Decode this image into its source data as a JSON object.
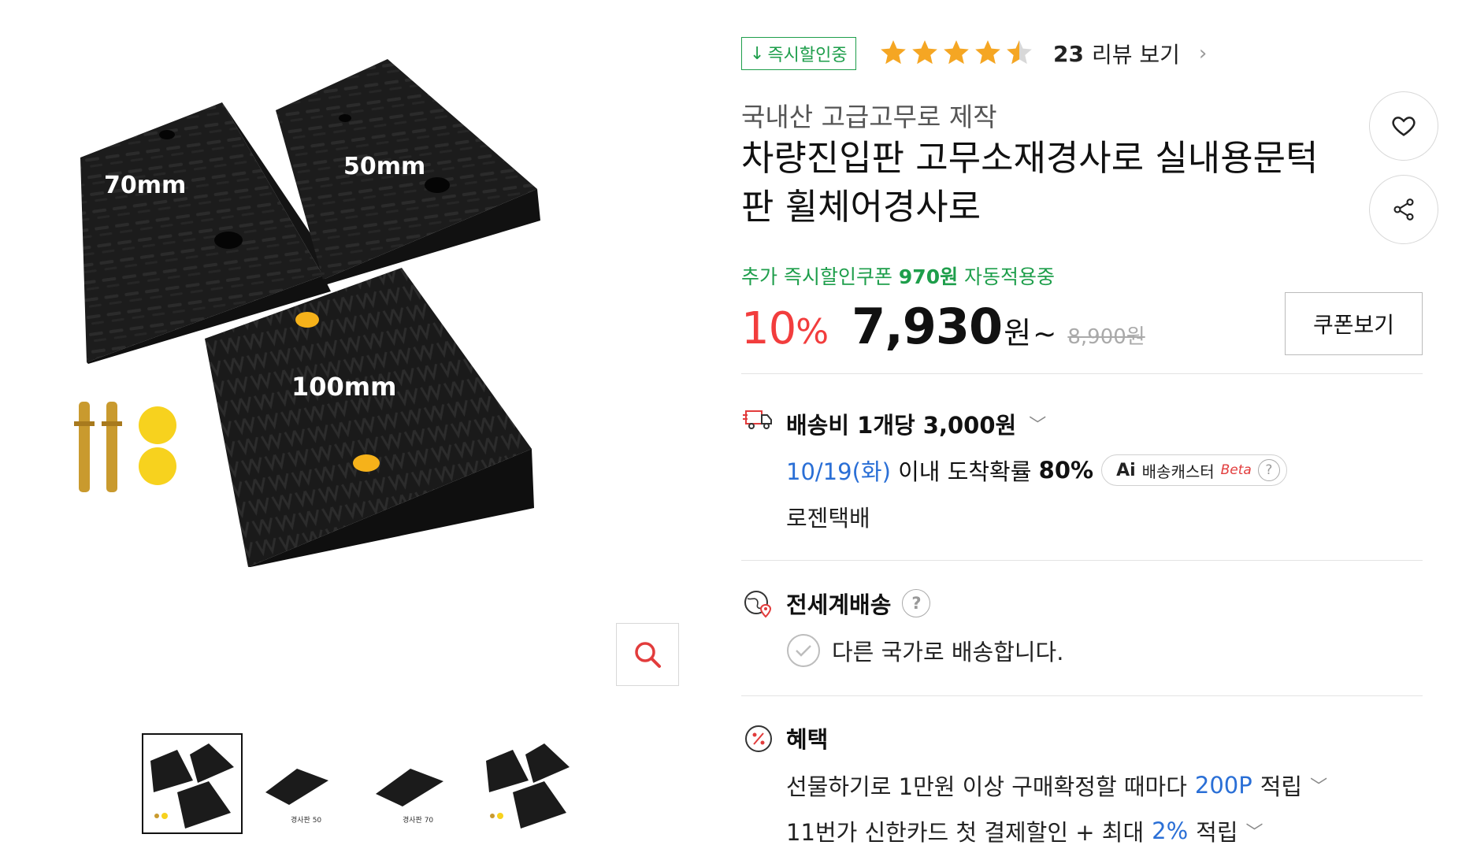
{
  "gallery": {
    "labels": {
      "ramp_small": "70mm",
      "ramp_mid": "50mm",
      "ramp_large": "100mm"
    },
    "thumbnails": [
      {
        "caption": ""
      },
      {
        "caption": "경사판 50"
      },
      {
        "caption": "경사판 70"
      },
      {
        "caption": ""
      }
    ],
    "active_thumbnail": 1
  },
  "badge": {
    "label": "즉시할인중",
    "icon": "arrow-down-icon"
  },
  "rating": {
    "value": 4.5,
    "max": 5,
    "review_count": "23",
    "review_label": "리뷰 보기"
  },
  "product": {
    "subtitle": "국내산 고급고무로 제작",
    "title": "차량진입판 고무소재경사로 실내용문턱판 휠체어경사로"
  },
  "coupon": {
    "prefix": "추가 즉시할인쿠폰",
    "amount": "970원",
    "suffix": "자동적용중"
  },
  "price": {
    "discount_num": "10",
    "discount_unit": "%",
    "sale": "7,930",
    "won": "원",
    "tilde": "~",
    "original": "8,900원",
    "coupon_button": "쿠폰보기"
  },
  "shipping": {
    "fee_label": "배송비 1개당 3,000원",
    "eta_date": "10/19(화)",
    "eta_text": "이내 도착확률",
    "eta_pct": "80%",
    "ai_label": "Ai",
    "ai_text": "배송캐스터",
    "ai_beta": "Beta",
    "carrier": "로젠택배"
  },
  "global_shipping": {
    "title": "전세계배송",
    "desc": "다른 국가로 배송합니다."
  },
  "benefits": {
    "title": "혜택",
    "line1_prefix": "선물하기로 1만원 이상 구매확정할 때마다",
    "line1_highlight": "200P",
    "line1_suffix": "적립",
    "line2_prefix": "11번가 신한카드 첫 결제할인 + 최대",
    "line2_highlight": "2%",
    "line2_suffix": "적립"
  },
  "colors": {
    "green": "#1e9e4b",
    "red": "#f23d3d",
    "blue": "#2a6fd6",
    "star": "#f5a623",
    "rubber": "#1b1b1b",
    "yellow": "#f6b21a"
  },
  "help_glyph": "?",
  "chevron_glyph": "〉",
  "arrow_glyph": "↓"
}
